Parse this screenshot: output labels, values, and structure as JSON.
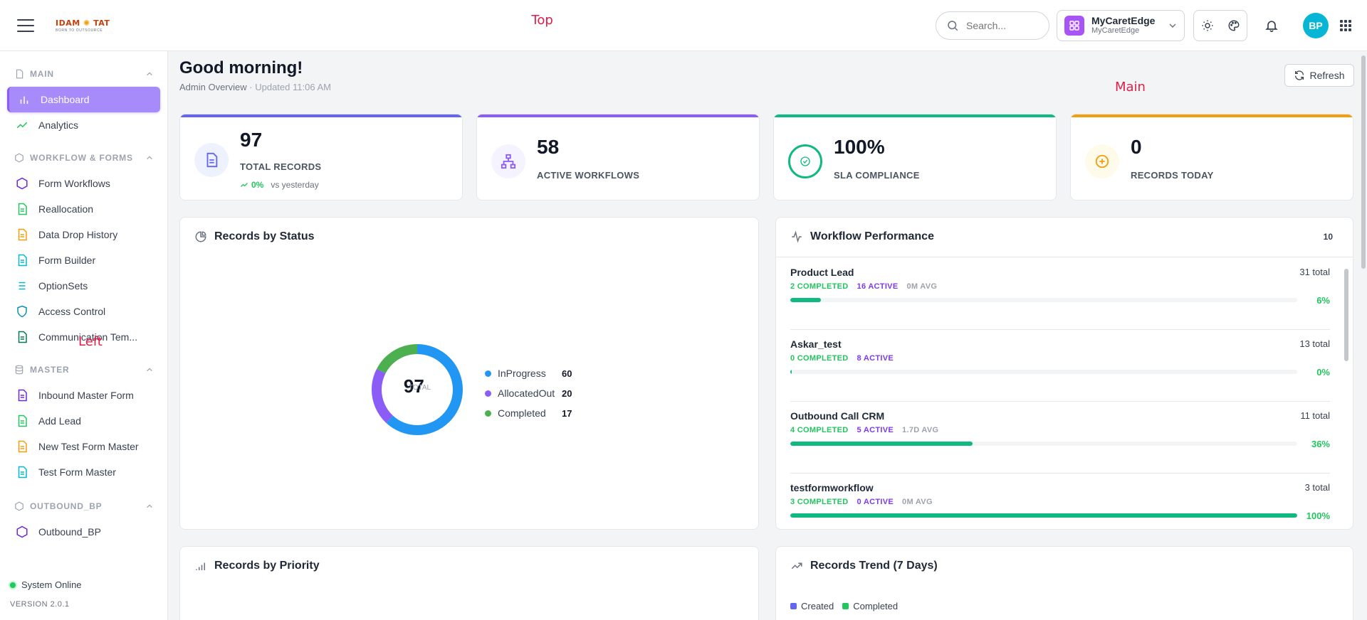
{
  "topbar": {
    "logo_text": "IDAM TAT",
    "logo_tagline": "BORN TO OUTSOURCE",
    "search_placeholder": "Search...",
    "tenant_name": "MyCaretEdge",
    "tenant_sub": "MyCaretEdge",
    "avatar_initials": "BP",
    "accent_color": "#a855f7",
    "avatar_color": "#06b6d4"
  },
  "sidebar": {
    "sections": [
      {
        "label": "MAIN",
        "items": [
          "Dashboard",
          "Analytics"
        ]
      },
      {
        "label": "WORKFLOW & FORMS",
        "items": [
          "Form Workflows",
          "Reallocation",
          "Data Drop History",
          "Form Builder",
          "OptionSets",
          "Access Control",
          "Communication Tem..."
        ]
      },
      {
        "label": "MASTER",
        "items": [
          "Inbound Master Form",
          "Add Lead",
          "New Test Form Master",
          "Test Form Master"
        ]
      },
      {
        "label": "OUTBOUND_BP",
        "items": [
          "Outbound_BP"
        ]
      }
    ],
    "status": "System Online",
    "version": "VERSION 2.0.1"
  },
  "main": {
    "greeting": "Good morning!",
    "subtitle": "Admin Overview",
    "updated": "Updated 11:06 AM",
    "refresh_label": "Refresh",
    "stats": [
      {
        "value": "97",
        "label": "TOTAL RECORDS",
        "delta": "0%",
        "delta_note": "vs yesterday",
        "color": "#6366f1"
      },
      {
        "value": "58",
        "label": "ACTIVE WORKFLOWS",
        "color": "#8b5cf6"
      },
      {
        "value": "100%",
        "label": "SLA COMPLIANCE",
        "color": "#10b981"
      },
      {
        "value": "0",
        "label": "RECORDS TODAY",
        "color": "#f59e0b"
      }
    ],
    "status_card": {
      "title": "Records by Status",
      "center_value": "97",
      "center_label": "TOTAL",
      "legend": [
        {
          "name": "InProgress",
          "value": "60",
          "color": "#2196f3"
        },
        {
          "name": "AllocatedOut",
          "value": "20",
          "color": "#8b5cf6"
        },
        {
          "name": "Completed",
          "value": "17",
          "color": "#4caf50"
        }
      ]
    },
    "workflow_card": {
      "title": "Workflow Performance",
      "count": "10",
      "items": [
        {
          "name": "Product Lead",
          "total": "31 total",
          "completed": "2 COMPLETED",
          "active": "16 ACTIVE",
          "avg": "0M AVG",
          "pct": "6%",
          "fill": 6
        },
        {
          "name": "Askar_test",
          "total": "13 total",
          "completed": "0 COMPLETED",
          "active": "8 ACTIVE",
          "avg": "",
          "pct": "0%",
          "fill": 0
        },
        {
          "name": "Outbound Call CRM",
          "total": "11 total",
          "completed": "4 COMPLETED",
          "active": "5 ACTIVE",
          "avg": "1.7D AVG",
          "pct": "36%",
          "fill": 36
        },
        {
          "name": "testformworkflow",
          "total": "3 total",
          "completed": "3 COMPLETED",
          "active": "0 ACTIVE",
          "avg": "0M AVG",
          "pct": "100%",
          "fill": 100
        }
      ]
    },
    "priority_card": {
      "title": "Records by Priority"
    },
    "trend_card": {
      "title": "Records Trend (7 Days)",
      "legend": [
        "Created",
        "Completed"
      ]
    }
  },
  "overlay_labels": {
    "top": "Top",
    "left": "Left",
    "main": "Main"
  }
}
